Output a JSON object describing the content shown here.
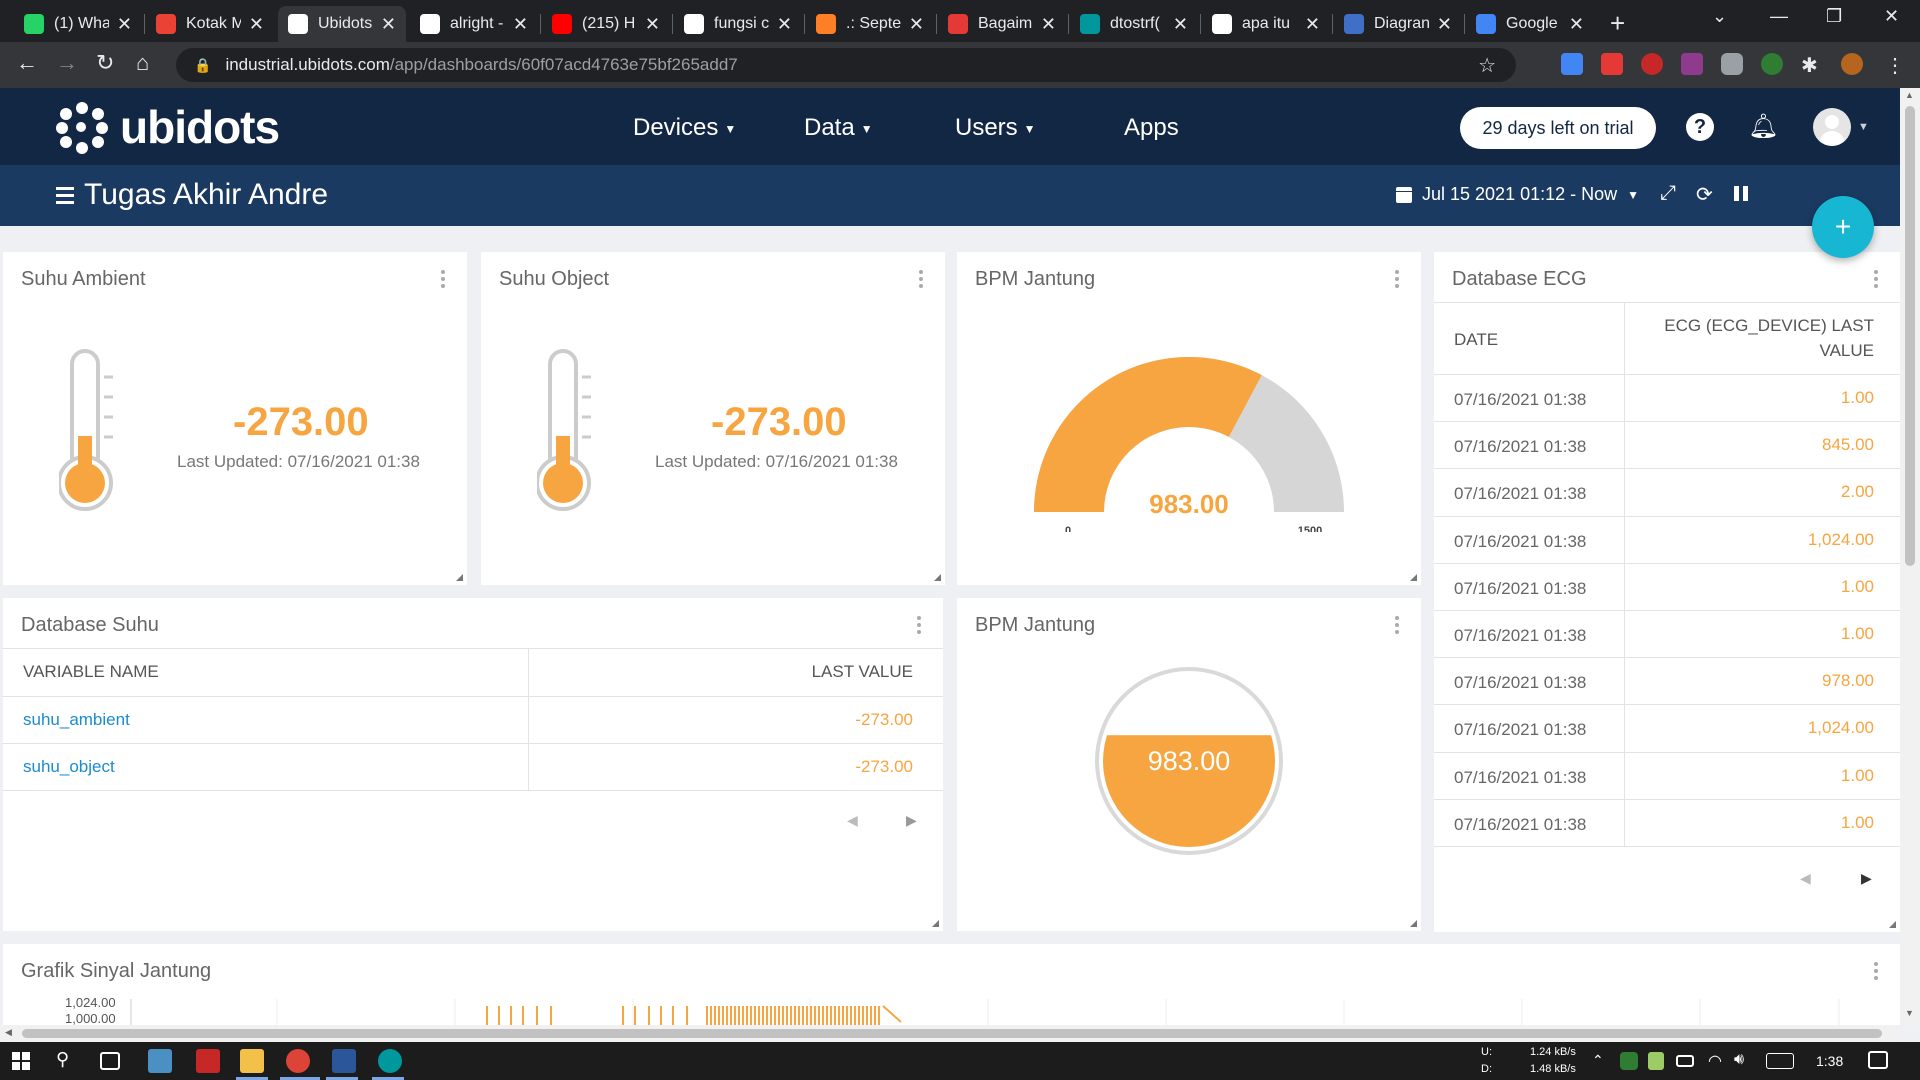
{
  "browser": {
    "tabs": [
      {
        "title": "(1) Wha",
        "icon": "whatsapp-icon",
        "color": "#25d366"
      },
      {
        "title": "Kotak M",
        "icon": "gmail-icon",
        "color": "#ea4335"
      },
      {
        "title": "Ubidots",
        "icon": "ubidots-icon",
        "color": "#ffffff"
      },
      {
        "title": "alright -",
        "icon": "google-icon",
        "color": "#ffffff"
      },
      {
        "title": "(215) H",
        "icon": "youtube-icon",
        "color": "#ff0000"
      },
      {
        "title": "fungsi c",
        "icon": "google-icon",
        "color": "#ffffff"
      },
      {
        "title": ".: Septer",
        "icon": "blogger-icon",
        "color": "#ff7f27"
      },
      {
        "title": "Bagaim",
        "icon": "qa-icon",
        "color": "#e53935"
      },
      {
        "title": "dtostrf(",
        "icon": "arduino-icon",
        "color": "#00979d"
      },
      {
        "title": "apa itu",
        "icon": "google-icon",
        "color": "#ffffff"
      },
      {
        "title": "Diagran",
        "icon": "diagram-icon",
        "color": "#3f6fc6"
      },
      {
        "title": "Google",
        "icon": "translate-icon",
        "color": "#4285f4"
      }
    ],
    "url_host": "industrial.ubidots.com",
    "url_path": "/app/dashboards/60f07acd4763e75bf265add7"
  },
  "app": {
    "logo_text": "ubidots",
    "nav": {
      "devices": "Devices",
      "data": "Data",
      "users": "Users",
      "apps": "Apps"
    },
    "trial": "29 days left on trial",
    "help": "?",
    "dashboard_title": "Tugas Akhir Andre",
    "date_range": "Jul 15 2021 01:12 - Now",
    "fab": "+"
  },
  "widgets": {
    "suhu_ambient": {
      "title": "Suhu Ambient",
      "value": "-273.00",
      "updated": "Last Updated: 07/16/2021 01:38",
      "fill": 0.25
    },
    "suhu_object": {
      "title": "Suhu Object",
      "value": "-273.00",
      "updated": "Last Updated: 07/16/2021 01:38",
      "fill": 0.25
    },
    "bpm_gauge": {
      "title": "BPM Jantung",
      "value": "983.00",
      "min": "0",
      "max": "1500",
      "min_value": 0,
      "max_value": 1500,
      "current": 983
    },
    "bpm_tank": {
      "title": "BPM Jantung",
      "value": "983.00",
      "fill": 0.65
    },
    "database_suhu": {
      "title": "Database Suhu",
      "headers": [
        "VARIABLE NAME",
        "LAST VALUE"
      ],
      "rows": [
        {
          "name": "suhu_ambient",
          "value": "-273.00"
        },
        {
          "name": "suhu_object",
          "value": "-273.00"
        }
      ]
    },
    "database_ecg": {
      "title": "Database ECG",
      "header_date": "DATE",
      "header_value_1": "ECG (ECG_DEVICE) LAST",
      "header_value_2": "VALUE",
      "rows": [
        {
          "date": "07/16/2021 01:38",
          "value": "1.00"
        },
        {
          "date": "07/16/2021 01:38",
          "value": "845.00"
        },
        {
          "date": "07/16/2021 01:38",
          "value": "2.00"
        },
        {
          "date": "07/16/2021 01:38",
          "value": "1,024.00"
        },
        {
          "date": "07/16/2021 01:38",
          "value": "1.00"
        },
        {
          "date": "07/16/2021 01:38",
          "value": "1.00"
        },
        {
          "date": "07/16/2021 01:38",
          "value": "978.00"
        },
        {
          "date": "07/16/2021 01:38",
          "value": "1,024.00"
        },
        {
          "date": "07/16/2021 01:38",
          "value": "1.00"
        },
        {
          "date": "07/16/2021 01:38",
          "value": "1.00"
        }
      ]
    },
    "grafik": {
      "title": "Grafik Sinyal Jantung",
      "y_top": "1,024.00",
      "y_second": "1,000.00"
    }
  },
  "taskbar": {
    "net_up_label": "U:",
    "net_down_label": "D:",
    "net_up": "1.24 kB/s",
    "net_down": "1.48 kB/s",
    "time": "1:38"
  },
  "colors": {
    "accent": "#f7a540",
    "navy": "#122744",
    "subnav": "#1b3a62",
    "fab": "#17b7d4",
    "gauge_rest": "#d6d6d6"
  }
}
